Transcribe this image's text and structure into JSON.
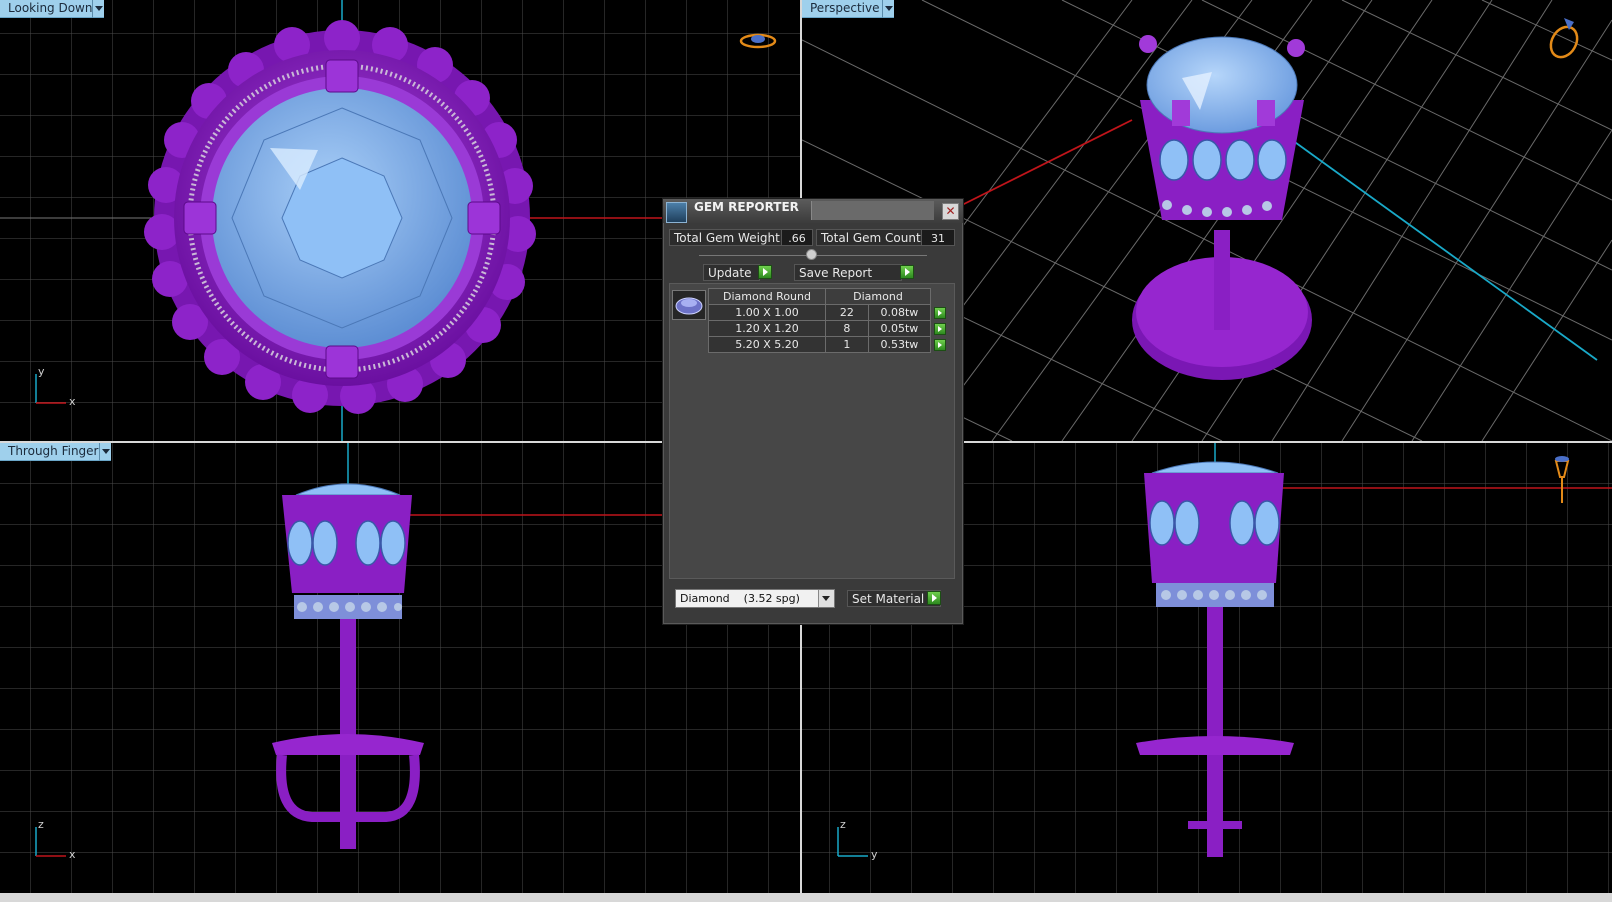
{
  "viewports": {
    "top_left": {
      "label": "Looking Down",
      "axis_v": "y",
      "axis_h": "x"
    },
    "top_right": {
      "label": "Perspective"
    },
    "bottom_left": {
      "label": "Through Finger",
      "axis_v": "z",
      "axis_h": "x"
    },
    "bottom_right": {
      "axis_v": "z",
      "axis_h": "y"
    }
  },
  "icons": {
    "ring_top": "ring-top-view-icon",
    "ring_persp": "ring-perspective-icon",
    "earring_side": "earring-side-icon"
  },
  "colors": {
    "accent_purple": "#8a1fc4",
    "gem_blue": "#7fb2ee",
    "viewport_label": "#9fd0ec",
    "grid": "#555555",
    "axis_red": "#c0141a",
    "axis_cyan": "#19a9c8",
    "go_green": "#3ea52a"
  },
  "dialog": {
    "title": "GEM REPORTER",
    "total_weight_label": "Total Gem Weight",
    "total_weight_value": ".66",
    "total_count_label": "Total Gem Count",
    "total_count_value": "31",
    "update_label": "Update",
    "save_report_label": "Save Report",
    "table": {
      "col_shape": "Diamond Round",
      "col_material": "Diamond",
      "rows": [
        {
          "size": "1.00 X 1.00",
          "count": "22",
          "weight": "0.08tw"
        },
        {
          "size": "1.20 X 1.20",
          "count": "8",
          "weight": "0.05tw"
        },
        {
          "size": "5.20 X 5.20",
          "count": "1",
          "weight": "0.53tw"
        }
      ]
    },
    "material_select": "Diamond    (3.52 spg)",
    "set_material_label": "Set Material"
  }
}
